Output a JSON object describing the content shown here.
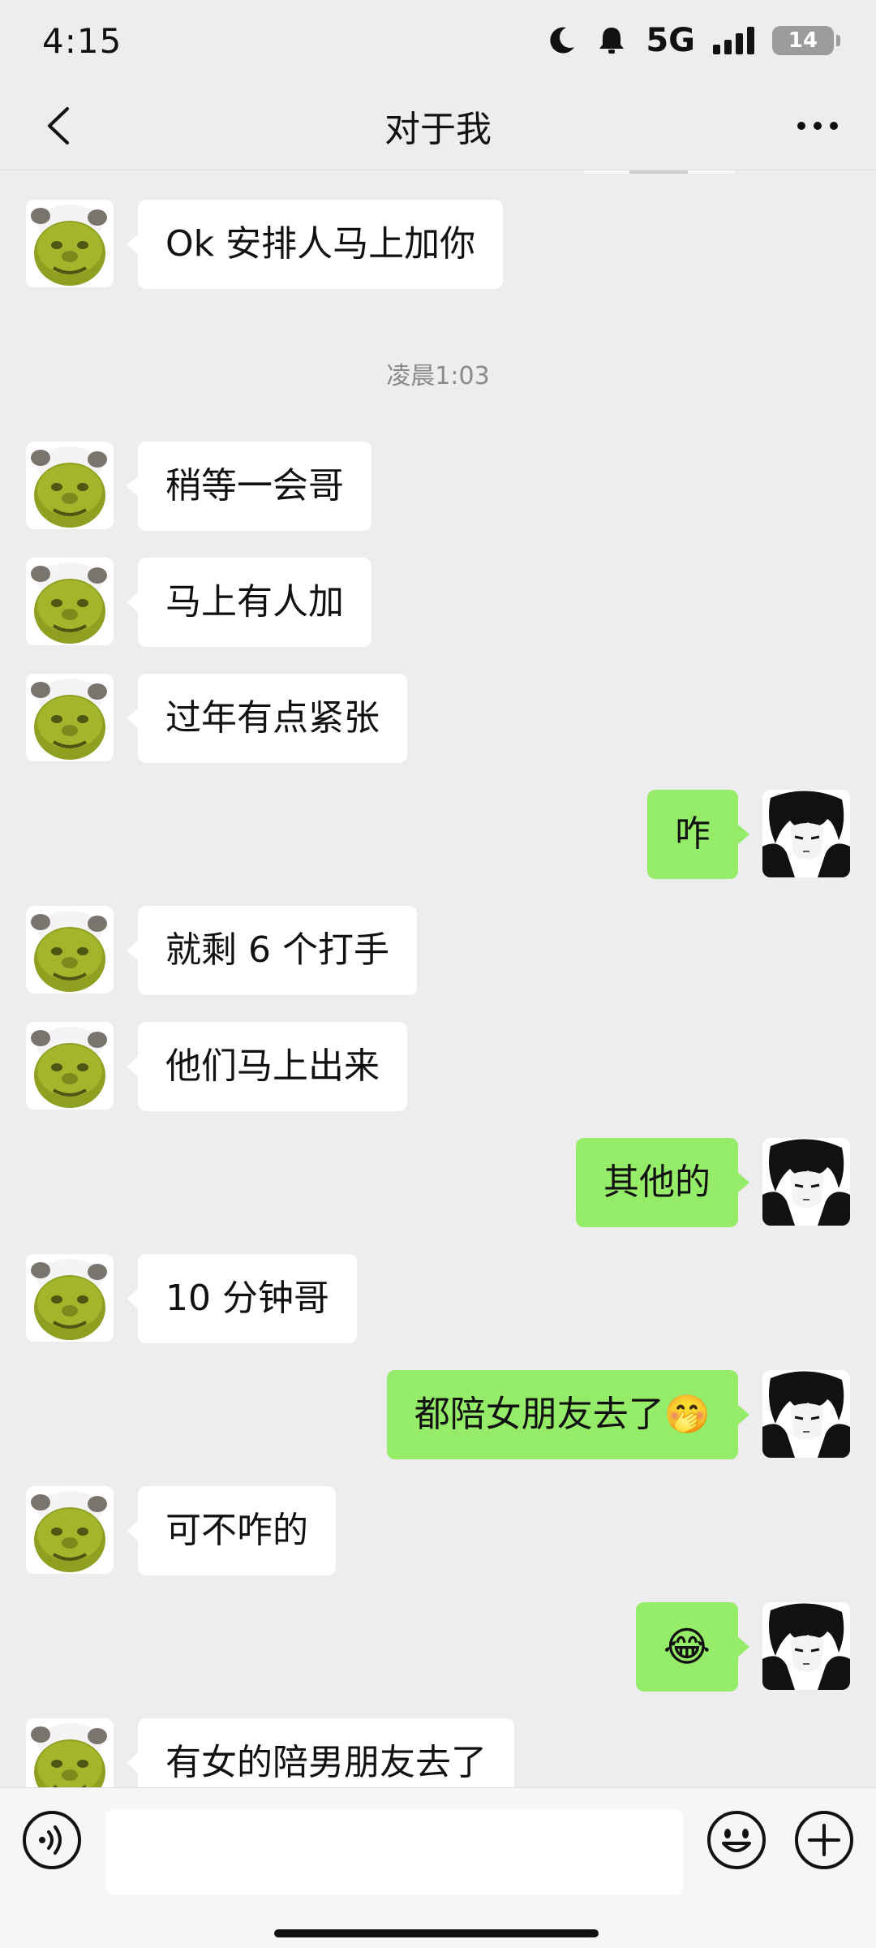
{
  "status_bar": {
    "time": "4:15",
    "network": "5G",
    "battery": "14"
  },
  "header": {
    "title": "对于我"
  },
  "chat": {
    "timestamp": "凌晨1:03",
    "messages": [
      {
        "side": "left",
        "text": "Ok 安排人马上加你"
      },
      {
        "side": "left",
        "text": "稍等一会哥"
      },
      {
        "side": "left",
        "text": "马上有人加"
      },
      {
        "side": "left",
        "text": "过年有点紧张"
      },
      {
        "side": "right",
        "text": "咋"
      },
      {
        "side": "left",
        "text": "就剩 6 个打手"
      },
      {
        "side": "left",
        "text": "他们马上出来"
      },
      {
        "side": "right",
        "text": "其他的"
      },
      {
        "side": "left",
        "text": "10 分钟哥"
      },
      {
        "side": "right",
        "text": "都陪女朋友去了",
        "emoji": "🤭"
      },
      {
        "side": "left",
        "text": "可不咋的"
      },
      {
        "side": "right",
        "text": "",
        "emoji": "😂"
      },
      {
        "side": "left",
        "text": "有女的陪男朋友去了"
      }
    ]
  },
  "input": {
    "value": "",
    "placeholder": ""
  },
  "icons": {
    "back": "chevron-left-icon",
    "more": "more-dots-icon",
    "voice": "voice-icon",
    "emoji": "emoji-icon",
    "plus": "plus-icon",
    "moon": "moon-icon",
    "bell": "bell-icon"
  },
  "colors": {
    "background": "#ededed",
    "outgoing_bubble": "#95ec69",
    "incoming_bubble": "#ffffff"
  }
}
